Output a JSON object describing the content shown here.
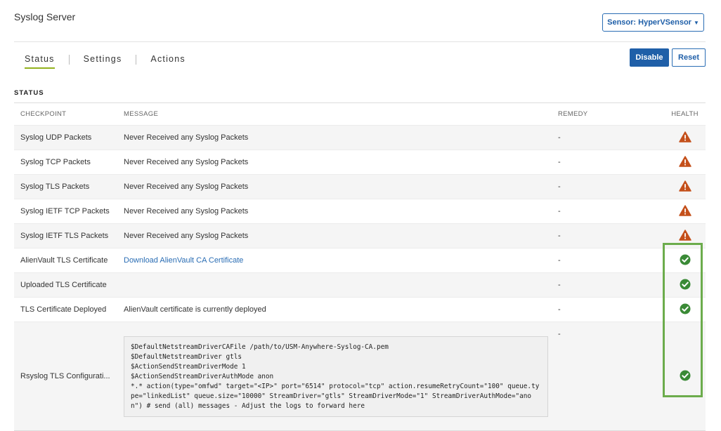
{
  "header": {
    "title": "Syslog Server",
    "sensor_label": "Sensor: HyperVSensor"
  },
  "tabs": [
    {
      "label": "Status",
      "active": true
    },
    {
      "label": "Settings",
      "active": false
    },
    {
      "label": "Actions",
      "active": false
    }
  ],
  "buttons": {
    "disable": "Disable",
    "reset": "Reset"
  },
  "section": {
    "title": "STATUS",
    "columns": {
      "checkpoint": "CHECKPOINT",
      "message": "MESSAGE",
      "remedy": "REMEDY",
      "health": "HEALTH"
    }
  },
  "rows": [
    {
      "checkpoint": "Syslog UDP Packets",
      "message": "Never Received any Syslog Packets",
      "remedy": "-",
      "health": "warning"
    },
    {
      "checkpoint": "Syslog TCP Packets",
      "message": "Never Received any Syslog Packets",
      "remedy": "-",
      "health": "warning"
    },
    {
      "checkpoint": "Syslog TLS Packets",
      "message": "Never Received any Syslog Packets",
      "remedy": "-",
      "health": "warning"
    },
    {
      "checkpoint": "Syslog IETF TCP Packets",
      "message": "Never Received any Syslog Packets",
      "remedy": "-",
      "health": "warning"
    },
    {
      "checkpoint": "Syslog IETF TLS Packets",
      "message": "Never Received any Syslog Packets",
      "remedy": "-",
      "health": "warning"
    },
    {
      "checkpoint": "AlienVault TLS Certificate",
      "message": "Download AlienVault CA Certificate",
      "remedy": "-",
      "health": "ok"
    },
    {
      "checkpoint": "Uploaded TLS Certificate",
      "message": "",
      "remedy": "-",
      "health": "ok"
    },
    {
      "checkpoint": "TLS Certificate Deployed",
      "message": "AlienVault certificate is currently deployed",
      "remedy": "-",
      "health": "ok"
    },
    {
      "checkpoint": "Rsyslog TLS Configurati...",
      "code_lines": [
        "$DefaultNetstreamDriverCAFile /path/to/USM-Anywhere-Syslog-CA.pem",
        "$DefaultNetstreamDriver gtls",
        "$ActionSendStreamDriverMode 1",
        "$ActionSendStreamDriverAuthMode anon",
        "*.* action(type=\"omfwd\" target=\"<IP>\" port=\"6514\" protocol=\"tcp\" action.resumeRetryCount=\"100\" queue.type=\"linkedList\" queue.size=\"10000\" StreamDriver=\"gtls\" StreamDriverMode=\"1\" StreamDriverAuthMode=\"anon\") # send (all) messages - Adjust the logs to forward here"
      ],
      "remedy": "-",
      "health": "ok"
    }
  ],
  "icons": {
    "warning": "warning-triangle-icon",
    "ok": "check-circle-icon"
  },
  "colors": {
    "primary": "#1f5fa8",
    "warning": "#c4501b",
    "ok": "#3a8a36",
    "highlight": "#6cac4c",
    "tab_underline": "#93b21d"
  }
}
